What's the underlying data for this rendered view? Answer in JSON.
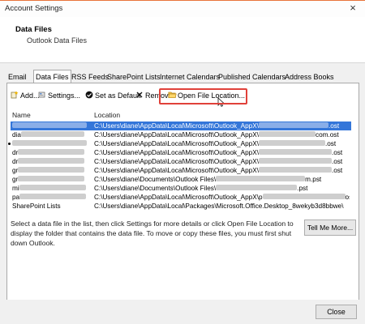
{
  "window": {
    "title": "Account Settings",
    "close_glyph": "×"
  },
  "header": {
    "title": "Data Files",
    "subtitle": "Outlook Data Files"
  },
  "tabs": [
    {
      "label": "Email"
    },
    {
      "label": "Data Files"
    },
    {
      "label": "RSS Feeds"
    },
    {
      "label": "SharePoint Lists"
    },
    {
      "label": "Internet Calendars"
    },
    {
      "label": "Published Calendars"
    },
    {
      "label": "Address Books"
    }
  ],
  "toolbar": {
    "add_label": "Add...",
    "settings_label": "Settings...",
    "set_default_label": "Set as Default",
    "remove_label": "Remove",
    "open_location_label": "Open File Location..."
  },
  "list": {
    "col_name": "Name",
    "col_location": "Location",
    "rows": [
      {
        "name_visible": "",
        "location_prefix": "C:\\Users\\diane\\AppData\\Local\\Microsoft\\Outlook_AppX\\",
        "location_suffix": ".ost",
        "selected": true
      },
      {
        "name_visible": "dia",
        "location_prefix": "C:\\Users\\diane\\AppData\\Local\\Microsoft\\Outlook_AppX\\",
        "location_suffix": "com.ost"
      },
      {
        "name_visible": "",
        "location_prefix": "C:\\Users\\diane\\AppData\\Local\\Microsoft\\Outlook_AppX\\",
        "location_suffix": ".ost",
        "default": true
      },
      {
        "name_visible": "dr",
        "location_prefix": "C:\\Users\\diane\\AppData\\Local\\Microsoft\\Outlook_AppX\\",
        "location_suffix": ".ost"
      },
      {
        "name_visible": "dr",
        "location_prefix": "C:\\Users\\diane\\AppData\\Local\\Microsoft\\Outlook_AppX\\",
        "location_suffix": ".ost"
      },
      {
        "name_visible": "gr",
        "location_prefix": "C:\\Users\\diane\\AppData\\Local\\Microsoft\\Outlook_AppX\\",
        "location_suffix": ".ost"
      },
      {
        "name_visible": "gr",
        "location_prefix": "C:\\Users\\diane\\Documents\\Outlook Files\\",
        "location_suffix": "m.pst"
      },
      {
        "name_visible": "mi",
        "location_prefix": "C:\\Users\\diane\\Documents\\Outlook Files\\",
        "location_suffix": ".pst"
      },
      {
        "name_visible": "pa",
        "location_prefix": "C:\\Users\\diane\\AppData\\Local\\Microsoft\\Outlook_AppX\\p",
        "location_suffix": "ost"
      },
      {
        "name_visible": "SharePoint Lists",
        "location_prefix": "C:\\Users\\diane\\AppData\\Local\\Packages\\Microsoft.Office.Desktop_8wekyb3d8bbwe\\",
        "location_suffix": ""
      }
    ]
  },
  "help": {
    "text": "Select a data file in the list, then click Settings for more details or click Open File Location to display the folder that contains the data file. To move or copy these files, you must first shut down Outlook.",
    "tell_me_more_label": "Tell Me More..."
  },
  "footer": {
    "close_label": "Close"
  },
  "colors": {
    "selection_blue": "#3476d9",
    "highlight_red": "#e0413a"
  },
  "icons": {
    "add": "add-icon",
    "settings": "settings-icon",
    "set_default": "checkmark-circle-icon",
    "remove": "x-remove-icon",
    "open_location": "folder-open-icon",
    "cursor": "mouse-pointer-icon"
  }
}
